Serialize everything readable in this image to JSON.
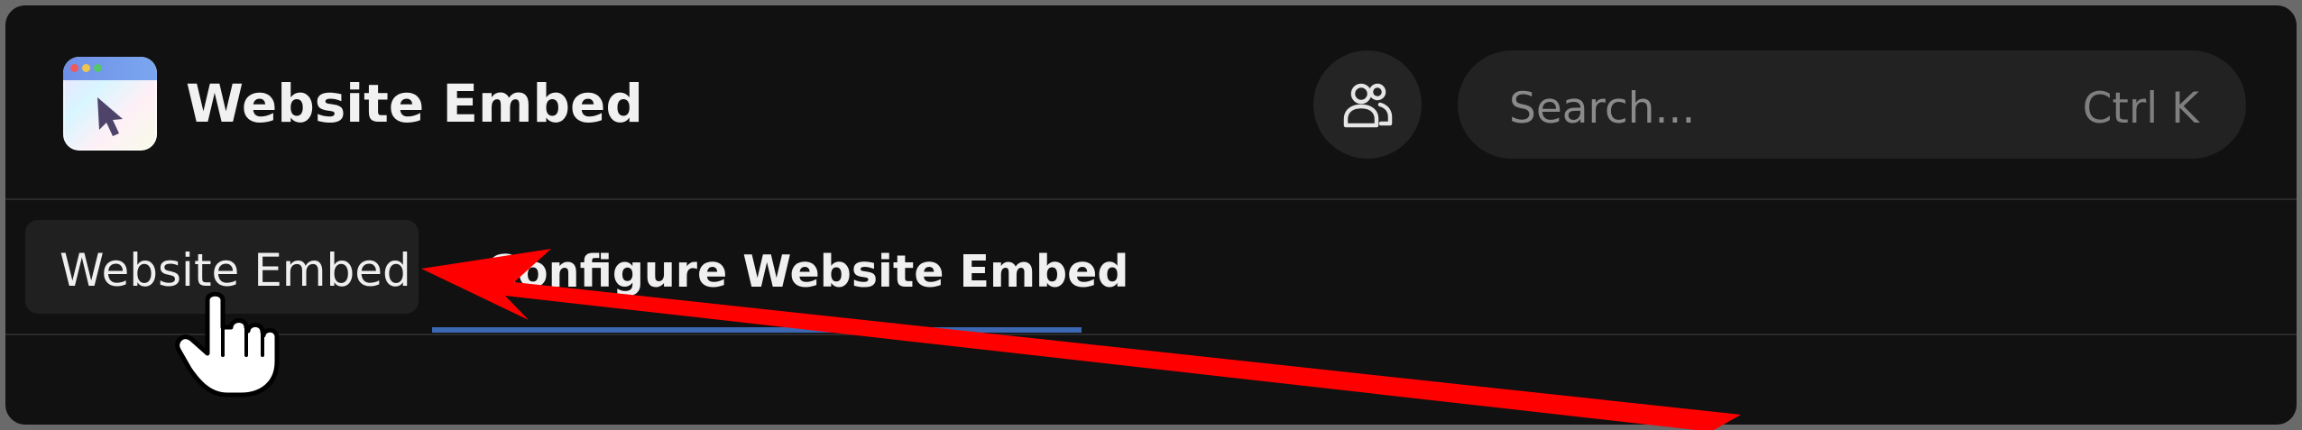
{
  "header": {
    "app_title": "Website Embed",
    "search": {
      "placeholder": "Search...",
      "shortcut": "Ctrl K"
    }
  },
  "breadcrumb": {
    "label": "Website Embed"
  },
  "tab": {
    "label": "Configure Website Embed"
  },
  "icons": {
    "app": "website-embed-icon",
    "people": "people-icon",
    "cursor": "hand-pointer-icon",
    "annotation": "red-arrow-annotation"
  },
  "colors": {
    "background": "#111111",
    "accent": "#3c67b3",
    "annotation": "#ff0000"
  }
}
